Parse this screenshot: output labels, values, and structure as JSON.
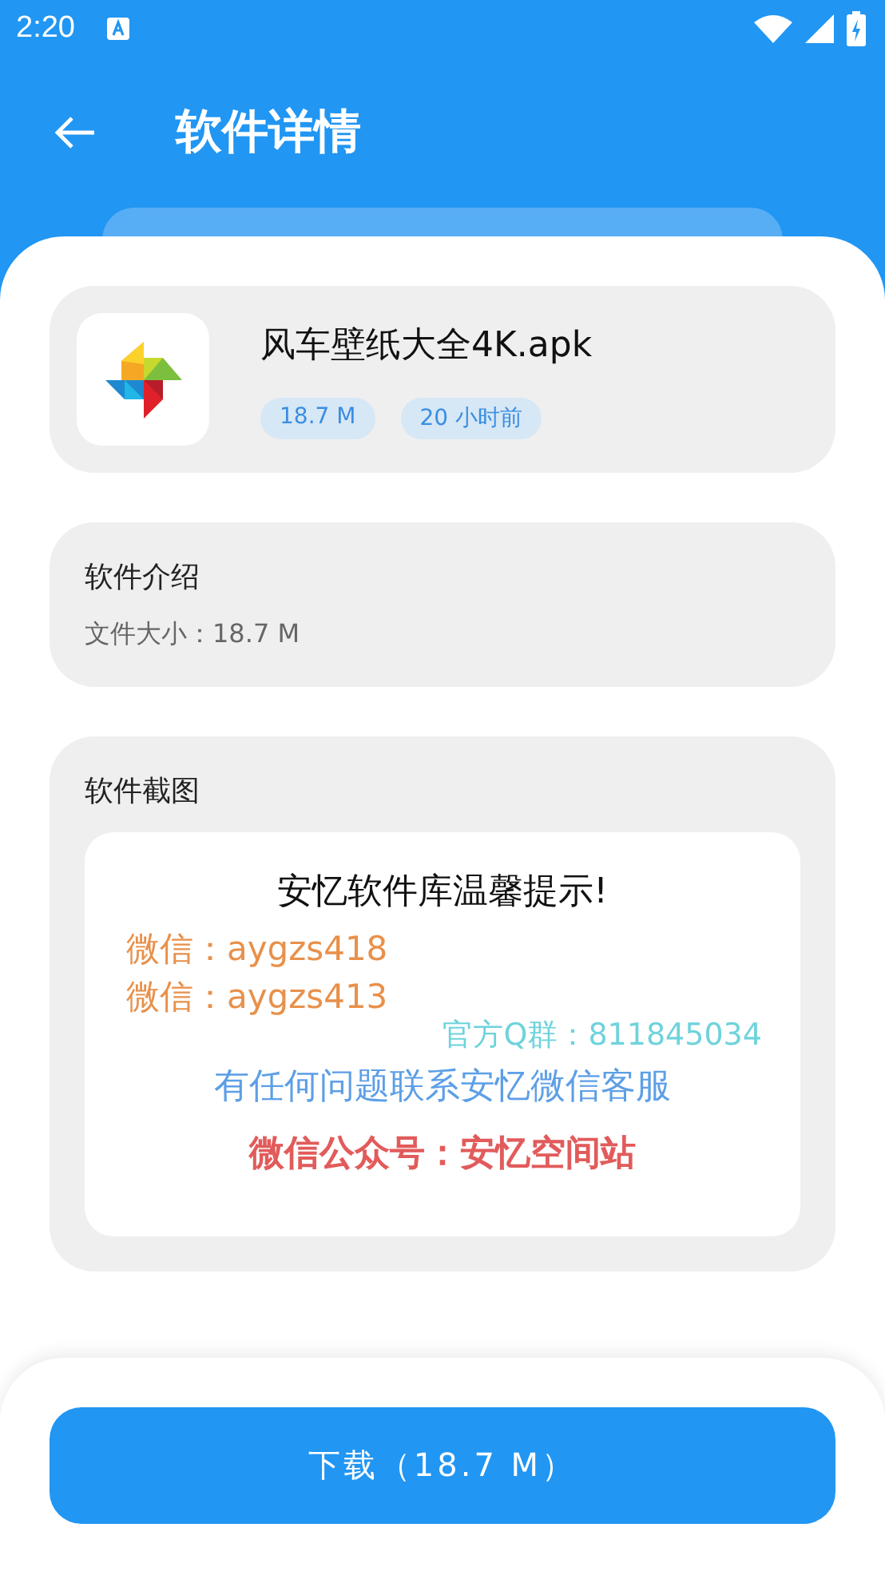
{
  "status_bar": {
    "time": "2:20"
  },
  "toolbar": {
    "title": "软件详情"
  },
  "app": {
    "name": "风车壁纸大全4K.apk",
    "tags": [
      "18.7 M",
      "20 小时前"
    ]
  },
  "intro": {
    "heading": "软件介绍",
    "text": "文件大小：18.7 M"
  },
  "screenshots": {
    "heading": "软件截图",
    "lines": [
      {
        "kind": "heading",
        "text": "安忆软件库温馨提示!",
        "color": "#111111"
      },
      {
        "kind": "contact",
        "text": "微信：aygzs418",
        "color": "#e8904a"
      },
      {
        "kind": "contact",
        "text": "微信：aygzs413",
        "color": "#e8904a"
      },
      {
        "kind": "group",
        "text": "官方Q群：811845034",
        "color": "#6fd3dc"
      },
      {
        "kind": "note",
        "text": "有任何问题联系安忆微信客服",
        "color": "#5d9fe6"
      },
      {
        "kind": "account",
        "text": "微信公众号：安忆空间站",
        "color": "#e25b5b"
      }
    ]
  },
  "download_button": {
    "label": "下载（18.7 M）"
  }
}
